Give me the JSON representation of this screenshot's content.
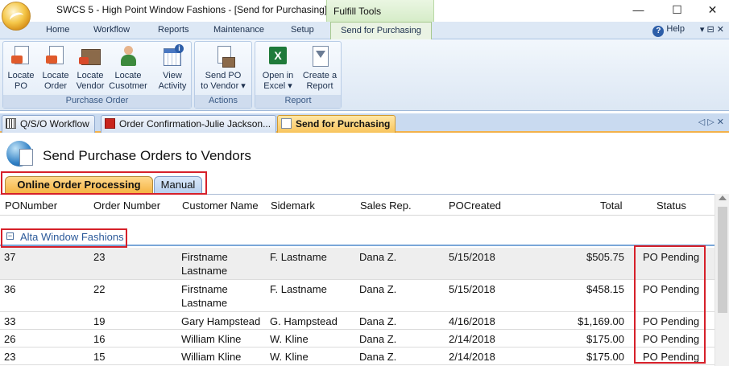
{
  "window": {
    "title": "SWCS 5 - High Point Window Fashions - [Send for Purchasing]",
    "context_tab": "Fulfill Tools",
    "minimize": "—",
    "maximize": "☐",
    "close": "✕"
  },
  "ribbon_tabs": [
    "Home",
    "Workflow",
    "Reports",
    "Maintenance",
    "Setup",
    "Send for Purchasing"
  ],
  "help": {
    "label": "Help",
    "ctrls": "▾  ⊟  ✕"
  },
  "ribbon": {
    "groups": [
      {
        "label": "Purchase Order",
        "buttons": [
          {
            "label": "Locate\nPO",
            "icon": "po-document-icon"
          },
          {
            "label": "Locate\nOrder",
            "icon": "order-document-icon"
          },
          {
            "label": "Locate\nVendor",
            "icon": "vendor-icon"
          },
          {
            "label": "Locate\nCusotmer",
            "icon": "customer-icon"
          },
          {
            "label": "View\nActivity",
            "icon": "activity-calendar-icon"
          }
        ]
      },
      {
        "label": "Actions",
        "buttons": [
          {
            "label": "Send PO\nto Vendor ▾",
            "icon": "send-po-icon"
          }
        ]
      },
      {
        "label": "Report",
        "buttons": [
          {
            "label": "Open in\nExcel ▾",
            "icon": "excel-icon"
          },
          {
            "label": "Create a\nReport",
            "icon": "report-icon"
          }
        ]
      }
    ]
  },
  "doc_tabs": [
    {
      "label": "Q/S/O Workflow",
      "icon": "workflow-icon"
    },
    {
      "label": "Order Confirmation-Julie Jackson...",
      "icon": "pdf-icon"
    },
    {
      "label": "Send for Purchasing",
      "icon": "document-icon"
    }
  ],
  "doc_tab_ctrls": "◁ ▷ ✕",
  "page": {
    "title": "Send Purchase Orders to Vendors",
    "subtabs": [
      "Online Order Processing",
      "Manual"
    ]
  },
  "grid": {
    "columns": [
      "PONumber",
      "Order Number",
      "Customer Name",
      "Sidemark",
      "Sales Rep.",
      "POCreated",
      "Total",
      "Status"
    ],
    "group": {
      "collapse": "−",
      "label": "Alta Window Fashions"
    },
    "rows": [
      {
        "po": "37",
        "order": "23",
        "customer": "Firstname Lastname",
        "sidemark": "F. Lastname",
        "rep": "Dana Z.",
        "created": "5/15/2018",
        "total": "$505.75",
        "status": "PO Pending"
      },
      {
        "po": "36",
        "order": "22",
        "customer": "Firstname Lastname",
        "sidemark": "F. Lastname",
        "rep": "Dana Z.",
        "created": "5/15/2018",
        "total": "$458.15",
        "status": "PO Pending"
      },
      {
        "po": "33",
        "order": "19",
        "customer": "Gary Hampstead",
        "sidemark": "G. Hampstead",
        "rep": "Dana Z.",
        "created": "4/16/2018",
        "total": "$1,169.00",
        "status": "PO Pending"
      },
      {
        "po": "26",
        "order": "16",
        "customer": "William Kline",
        "sidemark": "W. Kline",
        "rep": "Dana Z.",
        "created": "2/14/2018",
        "total": "$175.00",
        "status": "PO Pending"
      },
      {
        "po": "23",
        "order": "15",
        "customer": "William Kline",
        "sidemark": "W. Kline",
        "rep": "Dana Z.",
        "created": "2/14/2018",
        "total": "$175.00",
        "status": "PO Pending"
      }
    ]
  }
}
